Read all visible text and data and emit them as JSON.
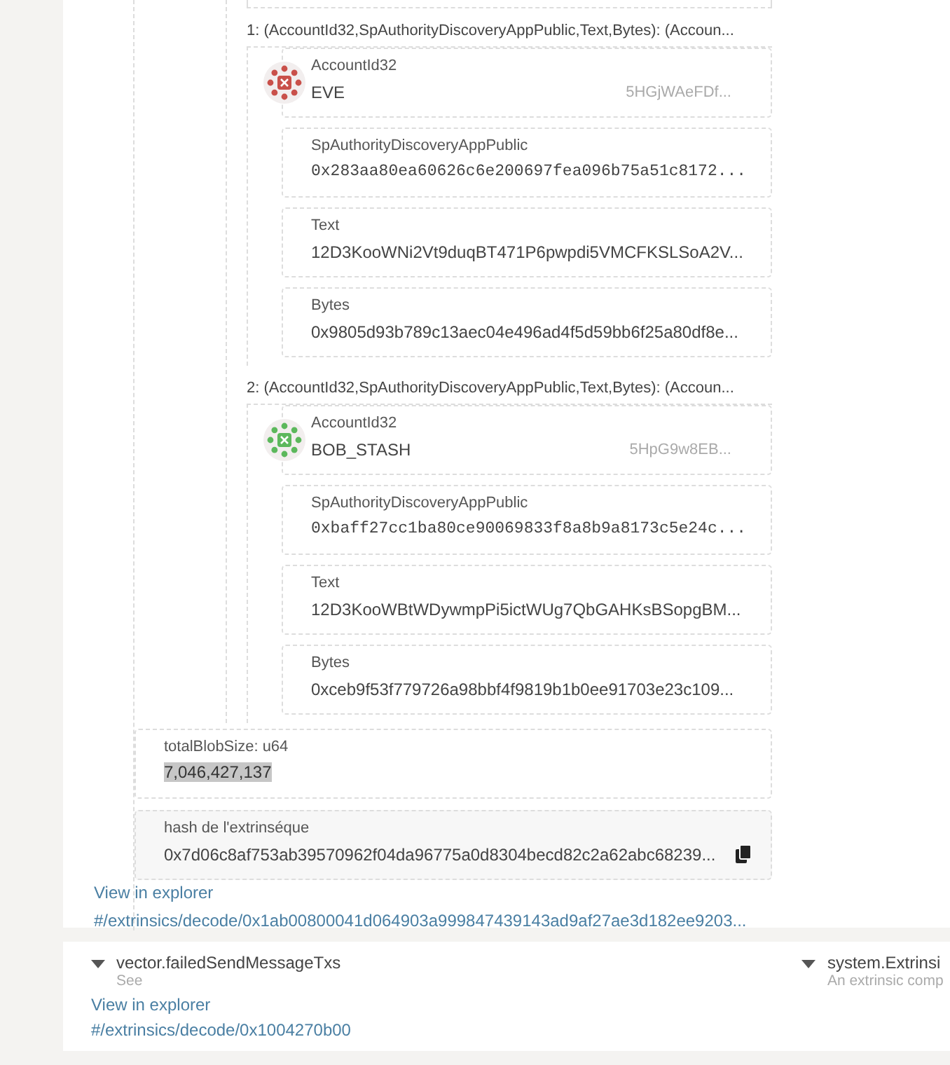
{
  "tuples": [
    {
      "header": "1: (AccountId32,SpAuthorityDiscoveryAppPublic,Text,Bytes): (Accoun...",
      "account": {
        "label": "AccountId32",
        "name": "EVE",
        "address": "5HGjWAeFDf...",
        "color": "#c9504a"
      },
      "fields": [
        {
          "label": "SpAuthorityDiscoveryAppPublic",
          "value": "0x283aa80ea60626c6e200697fea096b75a51c8172...",
          "kind": "mono"
        },
        {
          "label": "Text",
          "value": "12D3KooWNi2Vt9duqBT471P6pwpdi5VMCFKSLSoA2V...",
          "kind": "text"
        },
        {
          "label": "Bytes",
          "value": "0x9805d93b789c13aec04e496ad4f5d59bb6f25a80df8e...",
          "kind": "text"
        }
      ]
    },
    {
      "header": "2: (AccountId32,SpAuthorityDiscoveryAppPublic,Text,Bytes): (Accoun...",
      "account": {
        "label": "AccountId32",
        "name": "BOB_STASH",
        "address": "5HpG9w8EB...",
        "color": "#5cb85c"
      },
      "fields": [
        {
          "label": "SpAuthorityDiscoveryAppPublic",
          "value": "0xbaff27cc1ba80ce90069833f8a8b9a8173c5e24c...",
          "kind": "mono"
        },
        {
          "label": "Text",
          "value": "12D3KooWBtWDywmpPi5ictWUg7QbGAHKsBSopgBM...",
          "kind": "text"
        },
        {
          "label": "Bytes",
          "value": "0xceb9f53f779726a98bbf4f9819b1b0ee91703e23c109...",
          "kind": "text"
        }
      ]
    }
  ],
  "total": {
    "label": "totalBlobSize: u64",
    "value": "7,046,427,137",
    "selected": true
  },
  "hash": {
    "label": "hash de l'extrinséque",
    "value": "0x7d06c8af753ab39570962f04da96775a0d8304becd82c2a62abc68239..."
  },
  "explorer": {
    "label": "View in explorer",
    "path": "#/extrinsics/decode/0x1ab00800041d064903a999847439143ad9af27ae3d182ee9203..."
  },
  "events": [
    {
      "name": "vector.failedSendMessageTxs",
      "description": "See",
      "explorer": {
        "label": "View in explorer",
        "path": "#/extrinsics/decode/0x1004270b00"
      }
    },
    {
      "name": "system.Extrinsi",
      "description": "An extrinsic comp"
    }
  ]
}
